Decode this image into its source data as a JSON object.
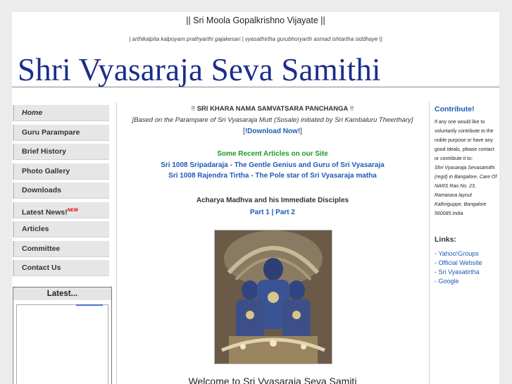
{
  "header": {
    "title": "|| Sri Moola Gopalkrishno Vijayate ||",
    "shloka": "| arthikalpita kalpoyam prathyarthi gajakesari | vyasathirtha gurubhoryarth asmad ishtartha siddhaye ||",
    "banner": "Shri Vyasaraja Seva Samithi"
  },
  "nav": {
    "items": [
      {
        "label": "Home"
      },
      {
        "label": "Guru Parampare"
      },
      {
        "label": "Brief History"
      },
      {
        "label": "Photo Gallery"
      },
      {
        "label": "Downloads"
      },
      {
        "label": "Latest News!",
        "badge": "NEW"
      },
      {
        "label": "Articles"
      },
      {
        "label": "Committee"
      },
      {
        "label": "Contact Us"
      }
    ]
  },
  "latest": {
    "title": "Latest..."
  },
  "main": {
    "panchanga_prefix": "!! ",
    "panchanga_title": "SRI KHARA NAMA SAMVATSARA PANCHANGA",
    "panchanga_suffix": " !!",
    "panchanga_note": "[Based on the Parampare of Sri Vyasaraja Mutt (Sosale) initiated by Sri Kambaluru Theerthary]",
    "download_prefix": "[",
    "download_label": "!Download Now!",
    "download_suffix": "]",
    "recent_heading": "Some Recent Articles on our Site",
    "article1": "Sri 1008 Sripadaraja - The Gentle Genius and Guru of Sri Vyasaraja",
    "article2": "Sri 1008 Rajendra Tirtha - The Pole star of Sri Vyasaraja matha",
    "acharya_title": "Acharya Madhva and his Immediate Disciples",
    "part1": "Part 1",
    "part_sep": " | ",
    "part2": "Part 2",
    "welcome": "Welcome to Sri Vyasaraja Seva Samiti"
  },
  "right": {
    "contribute_title": "Contribute!",
    "contribute_text": "If any one would like to voluntarily contribute to the noble purpose or have any good ideals, please contact or contribute it to:",
    "contribute_address": "Shri Vyasaraja Sevasamithi (regd) in Bangalore, Care Of NARS Rao No. 23, Ramarava layout Kathriguppe, Bangalore 560085 India",
    "links_title": "Links:",
    "links": [
      {
        "label": "- Yahoo!Groups"
      },
      {
        "label": "- Official Website"
      },
      {
        "label": "- Sri Vyasatirtha"
      },
      {
        "label": "- Google"
      }
    ]
  },
  "colors": {
    "banner_blue": "#1b2d8c",
    "link_blue": "#1f5ab5",
    "heading_green": "#1a9a27",
    "new_badge_red": "#dd0000"
  }
}
